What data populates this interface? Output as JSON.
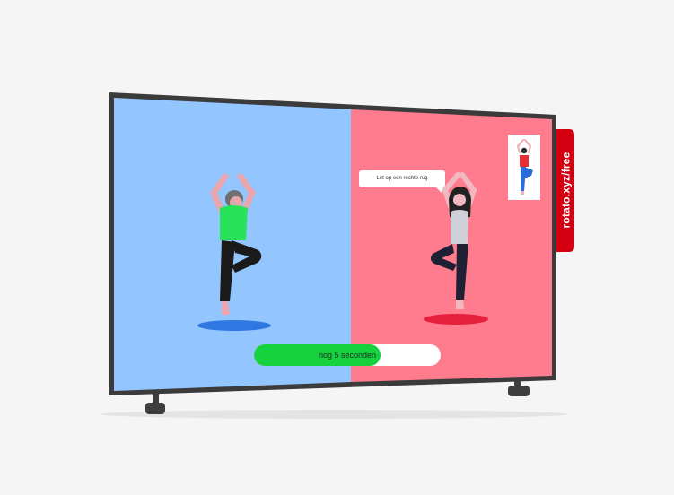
{
  "screen": {
    "left_color": "#93c5ff",
    "right_color": "#ff7b8e"
  },
  "coach": {
    "speech_bubble_text": "Let op een rechte rug"
  },
  "timer": {
    "label": "nog 5 seconden",
    "progress": 0.68,
    "accent_color": "#16d23c"
  },
  "watermark": {
    "text": "rotato.xyz/free",
    "color": "#d40012"
  }
}
